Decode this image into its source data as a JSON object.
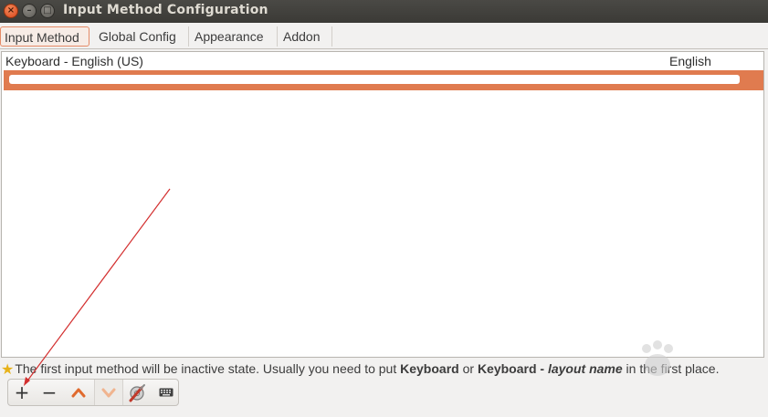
{
  "window": {
    "title": "Input Method Configuration",
    "buttons": {
      "close": "×",
      "minimize": "–",
      "maximize": "□"
    }
  },
  "tabs": [
    {
      "label": "Input Method",
      "active": true
    },
    {
      "label": "Global Config",
      "active": false
    },
    {
      "label": "Appearance",
      "active": false
    },
    {
      "label": "Addon",
      "active": false
    }
  ],
  "input_methods": [
    {
      "name": "Keyboard - English (US)",
      "language": "English",
      "selected": false
    }
  ],
  "hint": {
    "icon": "star-icon",
    "text_1": "The first input method will be inactive state. Usually you need to put ",
    "bold_1": "Keyboard",
    "text_2": " or ",
    "bold_2": "Keyboard - ",
    "italic_1": "layout name",
    "text_3": " in the first place."
  },
  "toolbar": {
    "add_label": "+",
    "remove_label": "−",
    "icons": [
      "plus-icon",
      "minus-icon",
      "move-up-icon",
      "move-down-icon",
      "configure-icon",
      "keyboard-layout-icon"
    ]
  },
  "colors": {
    "accent": "#e07b4f",
    "titlebar": "#3b3a36",
    "star": "#e7b21a"
  }
}
